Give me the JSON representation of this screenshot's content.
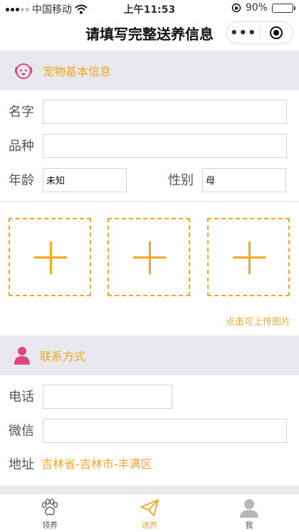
{
  "status_bar": {
    "carrier": "中国移动",
    "time": "上午11:53",
    "battery_percent": "90%",
    "battery_level": 0.9
  },
  "nav": {
    "title": "请填写完整送养信息",
    "more_glyph": "•••"
  },
  "pet_section": {
    "title": "宠物基本信息",
    "icon": "dog-face-icon",
    "name_label": "名字",
    "name_value": "",
    "breed_label": "品种",
    "breed_value": "",
    "age_label": "年龄",
    "age_value": "未知",
    "gender_label": "性别",
    "gender_value": "母"
  },
  "upload": {
    "slots": 3,
    "hint": "点击可上传图片"
  },
  "contact_section": {
    "title": "联系方式",
    "icon": "person-icon",
    "phone_label": "电话",
    "phone_value": "",
    "wechat_label": "微信",
    "wechat_value": "",
    "address_label": "地址",
    "address_value": "吉林省-吉林市-丰满区"
  },
  "tabs": [
    {
      "label": "领养",
      "icon": "paw-icon",
      "active": false
    },
    {
      "label": "送养",
      "icon": "paper-plane-icon",
      "active": true
    },
    {
      "label": "我",
      "icon": "user-icon",
      "active": false
    }
  ],
  "colors": {
    "accent": "#f5a623",
    "pink": "#e0447c",
    "section_bg": "#e9e8ec"
  }
}
